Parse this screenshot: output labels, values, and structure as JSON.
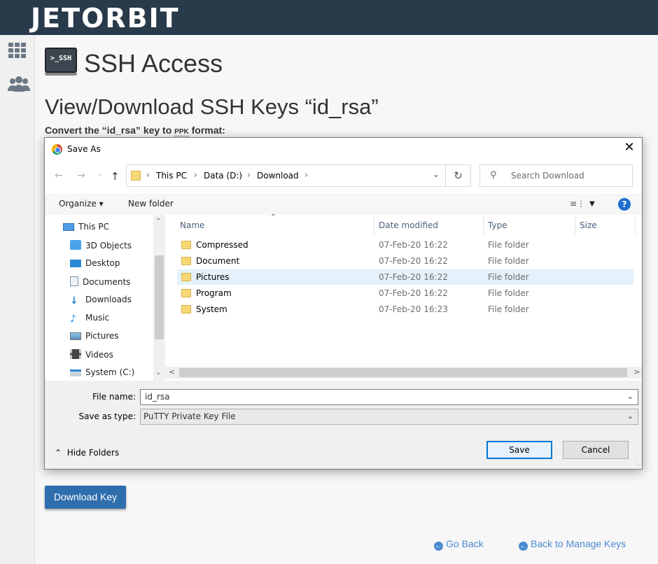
{
  "brand": {
    "logo": "JETORBIT"
  },
  "page": {
    "badge": ">_SSH",
    "title": "SSH Access",
    "section_title": "View/Download SSH Keys “id_rsa”",
    "convert_prefix": "Convert the “id_rsa” key to ",
    "convert_abbr": "PPK",
    "convert_suffix": " format:",
    "download_button": "Download Key",
    "go_back": "Go Back",
    "back_to_manage": "Back to Manage Keys"
  },
  "dialog": {
    "title": "Save As",
    "breadcrumbs": [
      "This PC",
      "Data (D:)",
      "Download"
    ],
    "search_placeholder": "Search Download",
    "organize": "Organize",
    "new_folder": "New folder",
    "tree": [
      "This PC",
      "3D Objects",
      "Desktop",
      "Documents",
      "Downloads",
      "Music",
      "Pictures",
      "Videos",
      "System (C:)"
    ],
    "columns": [
      "Name",
      "Date modified",
      "Type",
      "Size"
    ],
    "rows": [
      {
        "name": "Compressed",
        "date": "07-Feb-20 16:22",
        "type": "File folder"
      },
      {
        "name": "Document",
        "date": "07-Feb-20 16:22",
        "type": "File folder"
      },
      {
        "name": "Pictures",
        "date": "07-Feb-20 16:22",
        "type": "File folder"
      },
      {
        "name": "Program",
        "date": "07-Feb-20 16:22",
        "type": "File folder"
      },
      {
        "name": "System",
        "date": "07-Feb-20 16:23",
        "type": "File folder"
      }
    ],
    "selected_row": 2,
    "file_name_label": "File name:",
    "file_name_value": "id_rsa",
    "save_type_label": "Save as type:",
    "save_type_value": "PuTTY Private Key File",
    "hide_folders": "Hide Folders",
    "save": "Save",
    "cancel": "Cancel"
  }
}
